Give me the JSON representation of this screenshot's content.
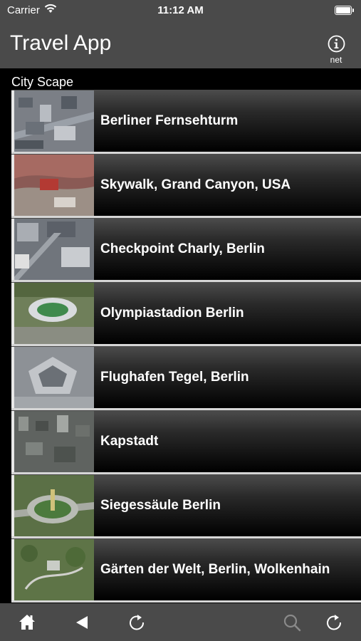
{
  "status": {
    "carrier": "Carrier",
    "time": "11:12 AM"
  },
  "nav": {
    "title": "Travel App",
    "info_label": "net"
  },
  "section": {
    "title": "City Scape"
  },
  "items": [
    {
      "label": "Berliner Fernsehturm"
    },
    {
      "label": "Skywalk, Grand Canyon, USA"
    },
    {
      "label": "Checkpoint Charly, Berlin"
    },
    {
      "label": "Olympiastadion Berlin"
    },
    {
      "label": "Flughafen Tegel, Berlin"
    },
    {
      "label": "Kapstadt"
    },
    {
      "label": "Siegessäule Berlin"
    },
    {
      "label": "Gärten der Welt, Berlin, Wolkenhain"
    }
  ],
  "toolbar": {
    "icons": [
      "home-icon",
      "back-icon",
      "reload-icon",
      "search-icon",
      "refresh-icon"
    ]
  },
  "colors": {
    "bar_bg": "#4a4a4a",
    "list_bg": "#000000",
    "separator": "#d6d6d6",
    "text": "#ffffff"
  }
}
